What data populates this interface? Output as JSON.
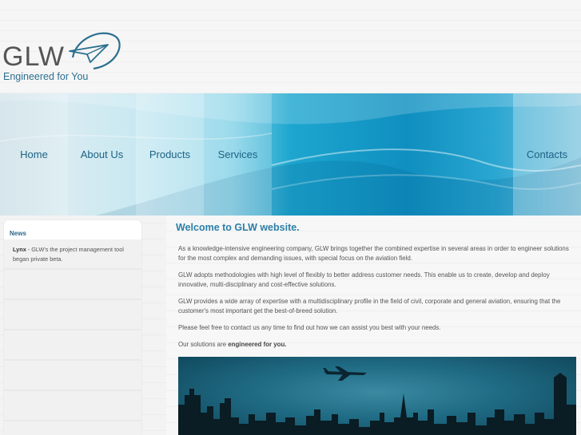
{
  "header": {
    "logo_text": "GLW",
    "tagline": "Engineered for You"
  },
  "nav": {
    "items": [
      {
        "label": "Home"
      },
      {
        "label": "About Us"
      },
      {
        "label": "Products"
      },
      {
        "label": "Services"
      },
      {
        "label": "Contacts"
      }
    ]
  },
  "sidebar": {
    "title": "News",
    "news_item_title": "Lynx",
    "news_item_text": " - GLW's the project management tool began private beta."
  },
  "main": {
    "welcome": "Welcome to GLW website.",
    "p1": "As a knowledge-intensive engineering company, GLW brings together the combined expertise in several areas in order to engineer solutions for the most complex and demanding issues, with special focus on the aviation field.",
    "p2": "GLW adopts methodologies with high level of flexibly to better address customer needs. This enable us to create, develop and deploy innovative, multi-disciplinary and cost-effective solutions.",
    "p3": "GLW provides a wide array of expertise with a multidisciplinary profile in the field of civil, corporate and general aviation, ensuring that the customer's most important get the best-of-breed solution.",
    "p4": "Please feel free to contact us any time to find out how we can assist you best with your needs.",
    "p5_prefix": "Our solutions are ",
    "p5_bold": "engineered for you."
  },
  "colors": {
    "accent": "#2b7fa8",
    "nav_text": "#1d6385"
  }
}
